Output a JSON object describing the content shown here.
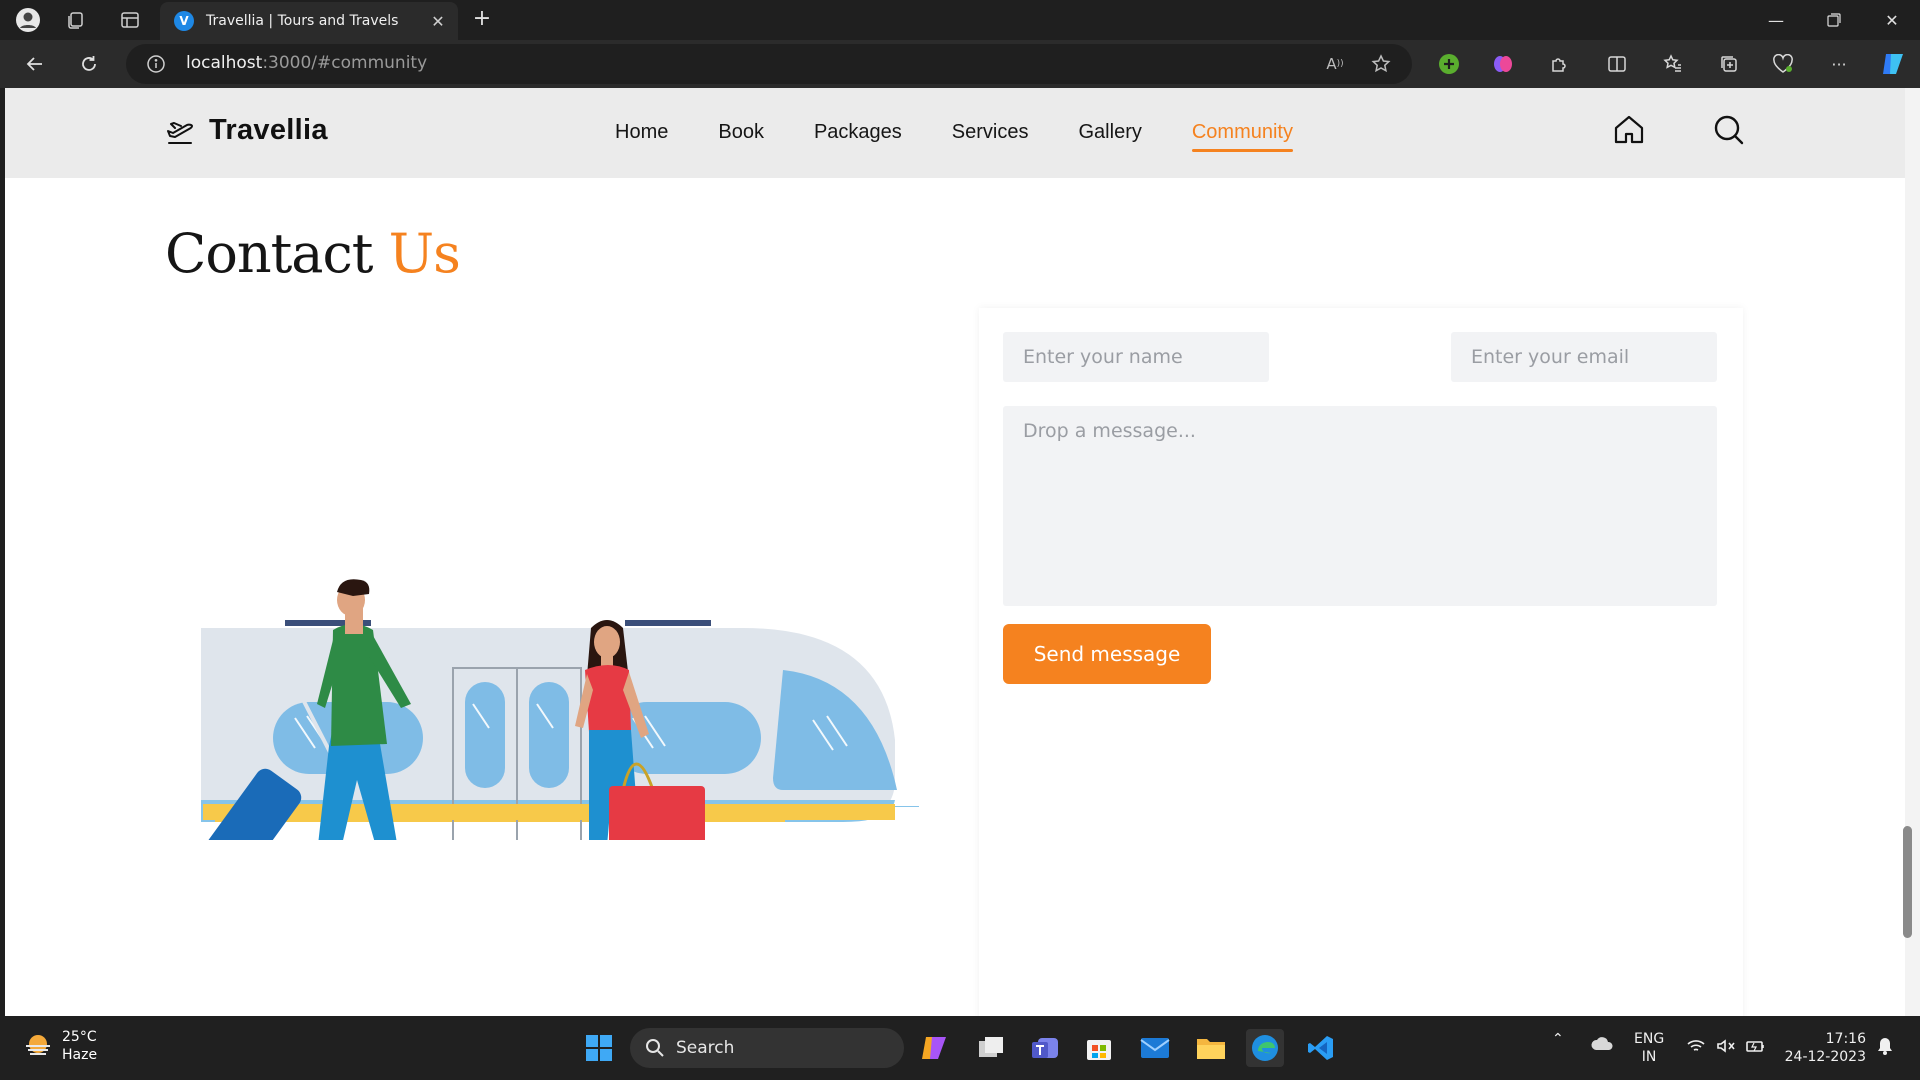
{
  "browser": {
    "tab_title": "Travellia | Tours and Travels",
    "tab_favicon_letter": "V",
    "url_host": "localhost",
    "url_rest": ":3000/#community"
  },
  "site": {
    "brand": "Travellia",
    "nav": [
      "Home",
      "Book",
      "Packages",
      "Services",
      "Gallery",
      "Community"
    ],
    "active_nav": "Community",
    "accent_color": "#f5821f"
  },
  "contact": {
    "title_main": "Contact",
    "title_accent": "Us",
    "name_placeholder": "Enter your name",
    "email_placeholder": "Enter your email",
    "message_placeholder": "Drop a message...",
    "send_label": "Send message"
  },
  "taskbar": {
    "temp": "25°C",
    "weather": "Haze",
    "search_label": "Search",
    "lang_1": "ENG",
    "lang_2": "IN",
    "time": "17:16",
    "date": "24-12-2023"
  }
}
